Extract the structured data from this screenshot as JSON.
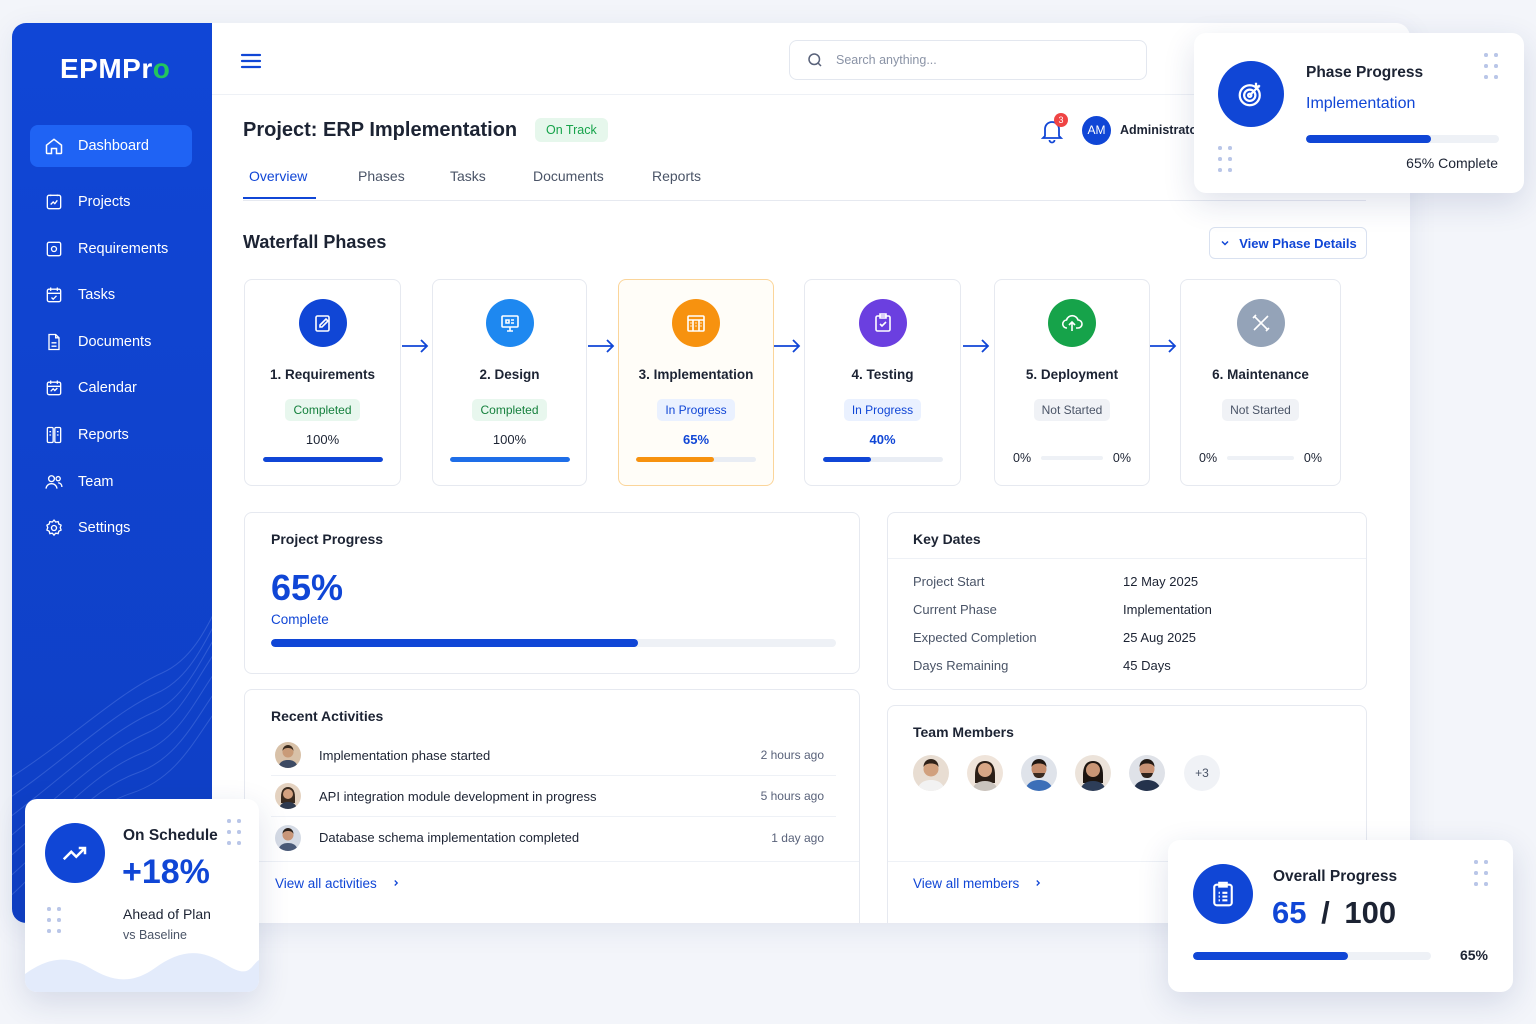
{
  "brand": {
    "prefix": "EPMPr",
    "suffix": "o"
  },
  "sidebar": {
    "items": [
      {
        "label": "Dashboard",
        "icon": "home-icon"
      },
      {
        "label": "Projects",
        "icon": "projects-icon"
      },
      {
        "label": "Requirements",
        "icon": "requirements-icon"
      },
      {
        "label": "Tasks",
        "icon": "tasks-icon"
      },
      {
        "label": "Documents",
        "icon": "documents-icon"
      },
      {
        "label": "Calendar",
        "icon": "calendar-icon"
      },
      {
        "label": "Reports",
        "icon": "reports-icon"
      },
      {
        "label": "Team",
        "icon": "team-icon"
      },
      {
        "label": "Settings",
        "icon": "settings-icon"
      }
    ]
  },
  "search": {
    "placeholder": "Search anything..."
  },
  "header": {
    "title": "Project: ERP Implementation",
    "status": "On Track",
    "notifications": "3",
    "user_initials": "AM",
    "user_name": "Administrator"
  },
  "tabs": [
    "Overview",
    "Phases",
    "Tasks",
    "Documents",
    "Reports"
  ],
  "phases_section": {
    "title": "Waterfall Phases",
    "details_button": "View Phase Details",
    "phases": [
      {
        "name": "1. Requirements",
        "status": "Completed",
        "percent": "100%",
        "progress": 100,
        "color": "#1046d6",
        "icon": "edit-document-icon"
      },
      {
        "name": "2. Design",
        "status": "Completed",
        "percent": "100%",
        "progress": 100,
        "color": "#1e88f0",
        "icon": "design-icon"
      },
      {
        "name": "3. Implementation",
        "status": "In Progress",
        "percent": "65%",
        "progress": 65,
        "color": "#f7920f",
        "icon": "building-icon"
      },
      {
        "name": "4. Testing",
        "status": "In Progress",
        "percent": "40%",
        "progress": 40,
        "color": "#6b3fe0",
        "icon": "testing-icon"
      },
      {
        "name": "5. Deployment",
        "status": "Not Started",
        "left_label": "0%",
        "right_label": "0%",
        "progress": 0,
        "color": "#16a34a",
        "icon": "cloud-upload-icon"
      },
      {
        "name": "6. Maintenance",
        "status": "Not Started",
        "left_label": "0%",
        "right_label": "0%",
        "progress": 0,
        "color": "#94a3b8",
        "icon": "tools-icon"
      }
    ]
  },
  "project_progress": {
    "title": "Project Progress",
    "value": "65%",
    "label": "Complete",
    "progress": 65
  },
  "key_dates": {
    "title": "Key Dates",
    "rows": [
      {
        "label": "Project Start",
        "value": "12 May 2025"
      },
      {
        "label": "Current Phase",
        "value": "Implementation"
      },
      {
        "label": "Expected Completion",
        "value": "25 Aug 2025"
      },
      {
        "label": "Days Remaining",
        "value": "45 Days"
      }
    ]
  },
  "recent_activities": {
    "title": "Recent Activities",
    "items": [
      {
        "text": "Implementation phase started",
        "time": "2 hours ago"
      },
      {
        "text": "API integration module development in progress",
        "time": "5 hours ago"
      },
      {
        "text": "Database schema implementation completed",
        "time": "1 day ago"
      }
    ],
    "link": "View all activities"
  },
  "team_members": {
    "title": "Team Members",
    "more": "+3",
    "link": "View all members"
  },
  "phase_progress_card": {
    "title": "Phase Progress",
    "phase": "Implementation",
    "percent_label": "65% Complete",
    "progress": 65
  },
  "schedule_card": {
    "title": "On Schedule",
    "value": "+18%",
    "subtitle": "Ahead of Plan",
    "note": "vs Baseline"
  },
  "overall_card": {
    "title": "Overall Progress",
    "value": "65",
    "separator": "/",
    "total": "100",
    "percent_label": "65%",
    "progress": 65
  },
  "colors": {
    "primary": "#1046d6",
    "success": "#16a34a",
    "warning": "#f7920f"
  }
}
